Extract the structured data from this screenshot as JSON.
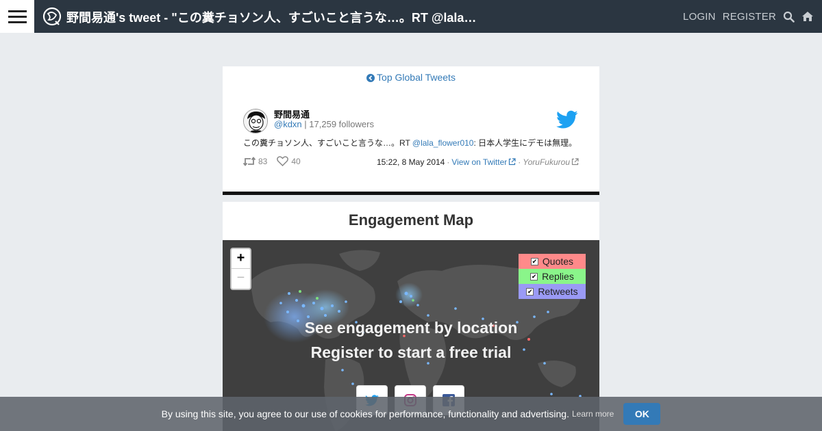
{
  "header": {
    "title": "野間易通's tweet - \"この糞チョソン人、すごいこと言うな…。RT @lala…",
    "login": "LOGIN",
    "register": "REGISTER"
  },
  "card": {
    "top_link": "Top Global Tweets",
    "user_name": "野間易通",
    "handle": "@kdxn",
    "followers": "| 17,259 followers",
    "tweet_before": "この糞チョソン人、すごいこと言うな…。RT ",
    "tweet_mention": "@lala_flower010",
    "tweet_after": ": 日本人学生にデモは無理。",
    "retweets": "83",
    "likes": "40",
    "time": "15:22, 8 May 2014",
    "view_link": "View on Twitter",
    "source": "YoruFukurou"
  },
  "engagement": {
    "heading": "Engagement Map",
    "zoom_in": "+",
    "zoom_out": "−",
    "legend": [
      {
        "label": "Quotes",
        "color": "#ff8a8a"
      },
      {
        "label": "Replies",
        "color": "#8af58a"
      },
      {
        "label": "Retweets",
        "color": "#9a9af5"
      }
    ],
    "check": "✔",
    "overlay_line1": "See engagement by location",
    "overlay_line2": "Register to start a free trial"
  },
  "cookie": {
    "message": "By using this site, you agree to our use of cookies for performance, functionality and advertising.",
    "learn_more": "Learn more",
    "ok": "OK"
  }
}
